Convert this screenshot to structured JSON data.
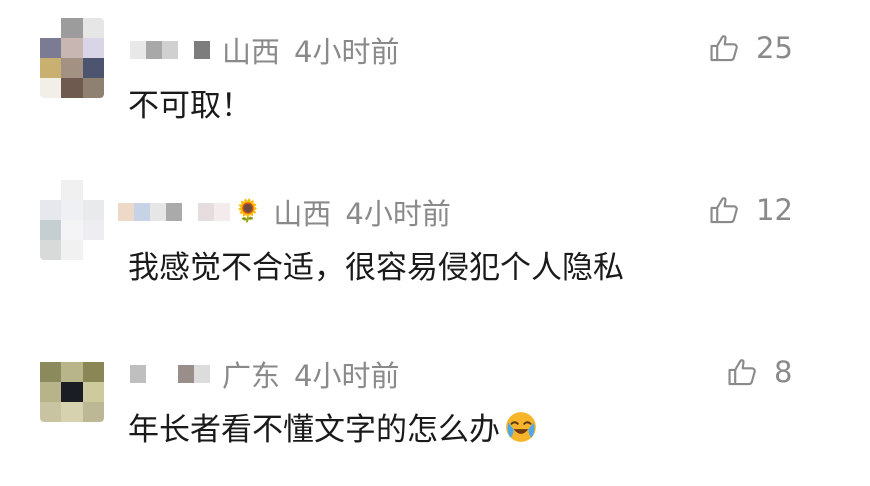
{
  "comments": [
    {
      "location": "山西",
      "time": "4小时前",
      "text": "不可取！",
      "likes": "25",
      "avatar_colors": [
        "#ffffff",
        "#9c9c9c",
        "#e6e6e6",
        "#7b7b93",
        "#c8b6b2",
        "#d9d4e6",
        "#c8b071",
        "#a39283",
        "#4c5470",
        "#f2eee8",
        "#6e5a4f",
        "#8f8171"
      ],
      "name_colors": [
        "#e8e8e8",
        "#a8a8a8",
        "#d0d0d0",
        "#ffffff",
        "#7d7d7d"
      ]
    },
    {
      "location": "山西",
      "time": "4小时前",
      "text": "我感觉不合适，很容易侵犯个人隐私",
      "likes": "12",
      "avatar_colors": [
        "#ffffff",
        "#f0f0f0",
        "#ffffff",
        "#e6e8ee",
        "#eef0f4",
        "#e9eaec",
        "#c5cfd1",
        "#f4f4f6",
        "#eeeef2",
        "#d8dada",
        "#f1f1f1",
        "#ffffff"
      ],
      "name_colors": [
        "#eed8c8",
        "#c6d2e6",
        "#e6e6e6",
        "#aaaaaa",
        "#ffffff",
        "#e6dede",
        "#f4ecec"
      ],
      "name_emoji": "🌻"
    },
    {
      "location": "广东",
      "time": "4小时前",
      "text": "年长者看不懂文字的怎么办",
      "likes": "8",
      "avatar_colors": [
        "#ffffff",
        "#ffffff",
        "#ffffff",
        "#8a8a5c",
        "#b9b58a",
        "#8a8656",
        "#b8b48a",
        "#1a1d24",
        "#cdca9e",
        "#c8c4a2",
        "#d6d2b0",
        "#bcb896"
      ],
      "name_colors": [
        "#bfbfbf",
        "#ffffff",
        "#ffffff",
        "#9a8e8a",
        "#dcdcdc"
      ],
      "text_emoji": "😭"
    }
  ],
  "colors": {
    "muted": "#8a8a8a",
    "text": "#1a1a1a",
    "background": "#ffffff"
  },
  "icons": {
    "like": "thumbs-up-icon"
  }
}
